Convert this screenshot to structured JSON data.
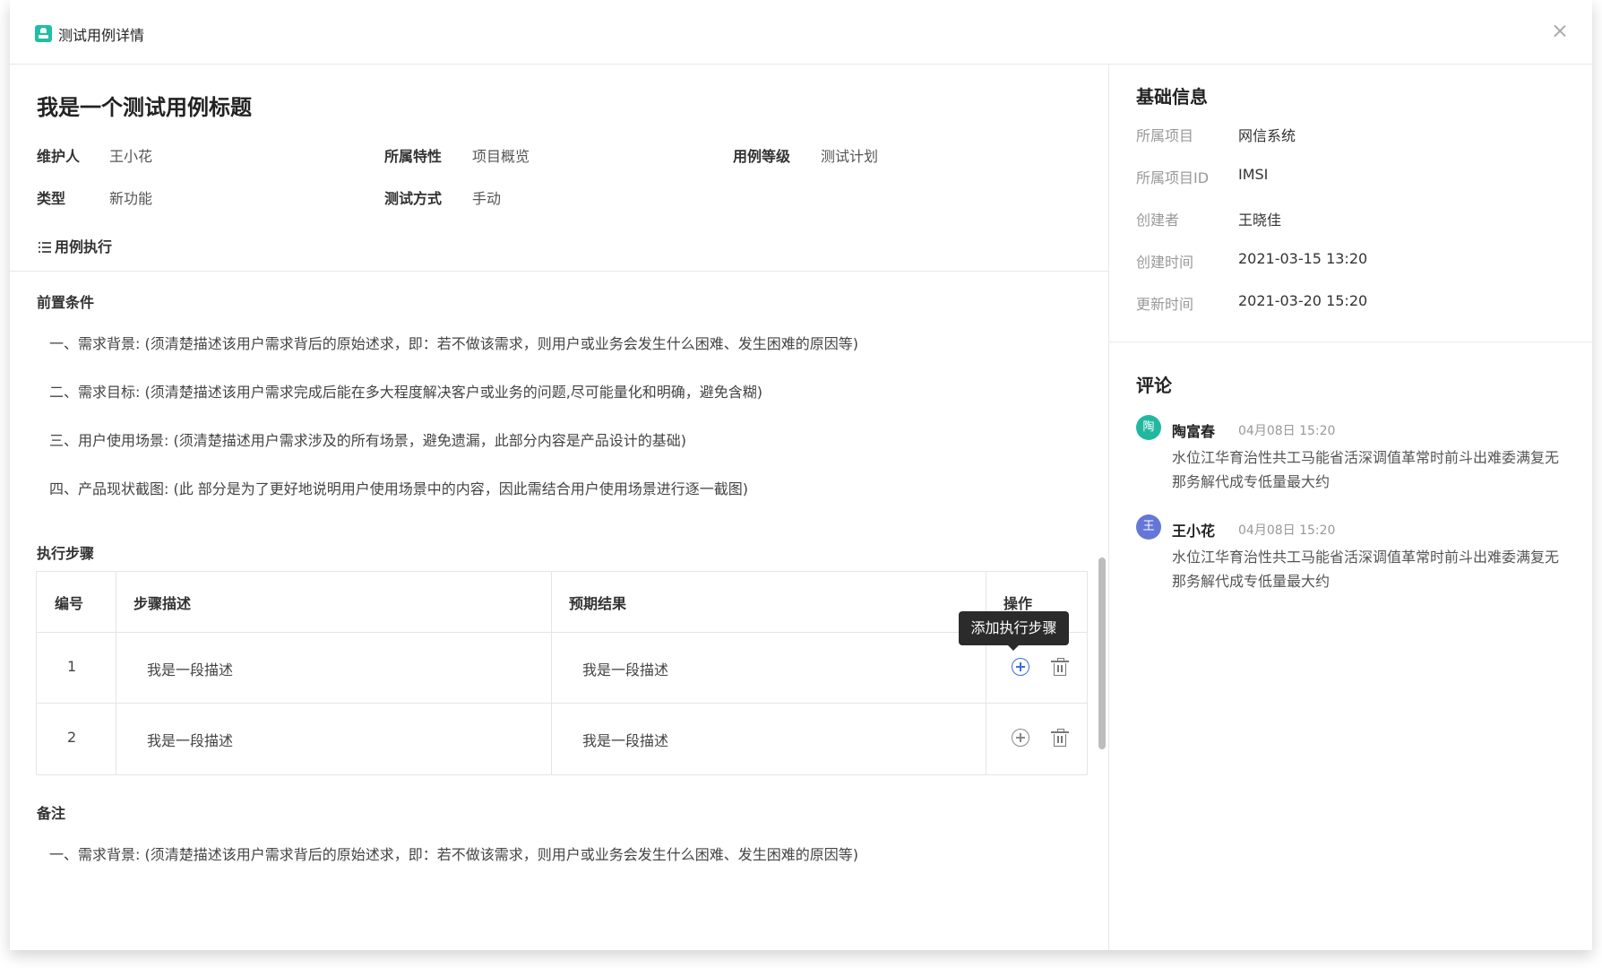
{
  "modal": {
    "title": "测试用例详情"
  },
  "case": {
    "title": "我是一个测试用例标题",
    "meta": [
      {
        "label": "维护人",
        "value": "王小花"
      },
      {
        "label": "所属特性",
        "value": "项目概览"
      },
      {
        "label": "用例等级",
        "value": "测试计划"
      },
      {
        "label": "类型",
        "value": "新功能"
      },
      {
        "label": "测试方式",
        "value": "手动"
      }
    ],
    "section_toggle": "用例执行"
  },
  "preconditions": {
    "heading": "前置条件",
    "items": [
      "一、需求背景: (须清楚描述该用户需求背后的原始述求，即：若不做该需求，则用户或业务会发生什么困难、发生困难的原因等)",
      "二、需求目标: (须清楚描述该用户需求完成后能在多大程度解决客户或业务的问题,尽可能量化和明确，避免含糊)",
      "三、用户使用场景: (须清楚描述用户需求涉及的所有场景，避免遗漏，此部分内容是产品设计的基础)",
      "四、产品现状截图: (此 部分是为了更好地说明用户使用场景中的内容，因此需结合用户使用场景进行逐一截图)"
    ]
  },
  "steps": {
    "heading": "执行步骤",
    "columns": [
      "编号",
      "步骤描述",
      "预期结果",
      "操作"
    ],
    "rows": [
      {
        "no": "1",
        "desc": "我是一段描述",
        "expected": "我是一段描述"
      },
      {
        "no": "2",
        "desc": "我是一段描述",
        "expected": "我是一段描述"
      }
    ],
    "tooltip": "添加执行步骤"
  },
  "notes": {
    "heading": "备注",
    "items": [
      "一、需求背景: (须清楚描述该用户需求背后的原始述求，即：若不做该需求，则用户或业务会发生什么困难、发生困难的原因等)"
    ]
  },
  "basic_info": {
    "heading": "基础信息",
    "fields": [
      {
        "label": "所属项目",
        "value": "网信系统"
      },
      {
        "label": "所属项目ID",
        "value": "IMSI"
      },
      {
        "label": "创建者",
        "value": "王晓佳"
      },
      {
        "label": "创建时间",
        "value": "2021-03-15 13:20"
      },
      {
        "label": "更新时间",
        "value": "2021-03-20 15:20"
      }
    ]
  },
  "comments": {
    "heading": "评论",
    "items": [
      {
        "avatar_text": "陶",
        "avatar_color": "#22b8a0",
        "author": "陶富春",
        "time": "04月08日 15:20",
        "text": "水位江华育治性共工马能省活深调值革常时前斗出难委满复无那务解代成专低量最大约"
      },
      {
        "avatar_text": "王",
        "avatar_color": "#6577d6",
        "author": "王小花",
        "time": "04月08日 15:20",
        "text": "水位江华育治性共工马能省活深调值革常时前斗出难委满复无那务解代成专低量最大约"
      }
    ]
  },
  "colors": {
    "accent": "#3b6fd8",
    "brand": "#1fbfa3"
  }
}
